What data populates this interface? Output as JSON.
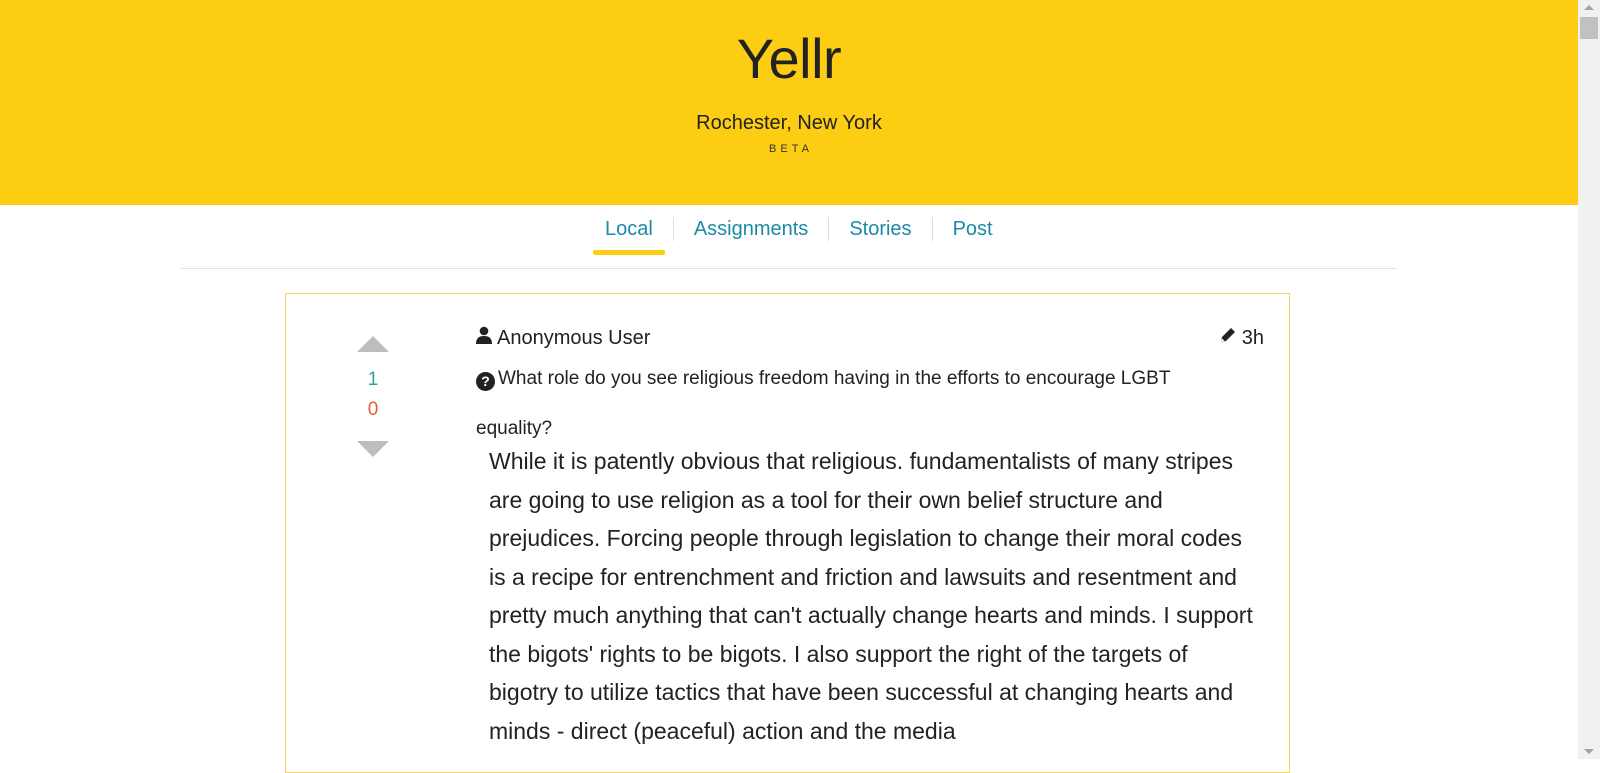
{
  "header": {
    "title": "Yellr",
    "location": "Rochester, New York",
    "badge": "BETA"
  },
  "nav": {
    "tabs": [
      {
        "label": "Local",
        "active": true
      },
      {
        "label": "Assignments",
        "active": false
      },
      {
        "label": "Stories",
        "active": false
      },
      {
        "label": "Post",
        "active": false
      }
    ]
  },
  "post": {
    "author": "Anonymous User",
    "author_icon": "user-icon",
    "time": "3h",
    "time_icon": "pencil-icon",
    "question_icon": "question-circle-icon",
    "question": "What role do you see religious freedom having in the efforts to encourage LGBT equality?",
    "votes": {
      "up": "1",
      "down": "0"
    },
    "body": "While it is patently obvious that religious. fundamentalists of many stripes are going to use religion as a tool for their own belief structure and prejudices. Forcing people through legislation to change their moral codes is a recipe for entrenchment and friction and lawsuits and resentment and pretty much anything that can't actually change hearts and minds. I support the bigots' rights to be bigots. I also support the right of the targets of bigotry to utilize tactics that have been successful at changing hearts and minds - direct (peaceful) action and the media"
  },
  "colors": {
    "brand_yellow": "#fdcd14",
    "link_teal": "#1c8aa6",
    "upvote_green": "#2ba4a0",
    "downvote_red": "#e0613b"
  }
}
